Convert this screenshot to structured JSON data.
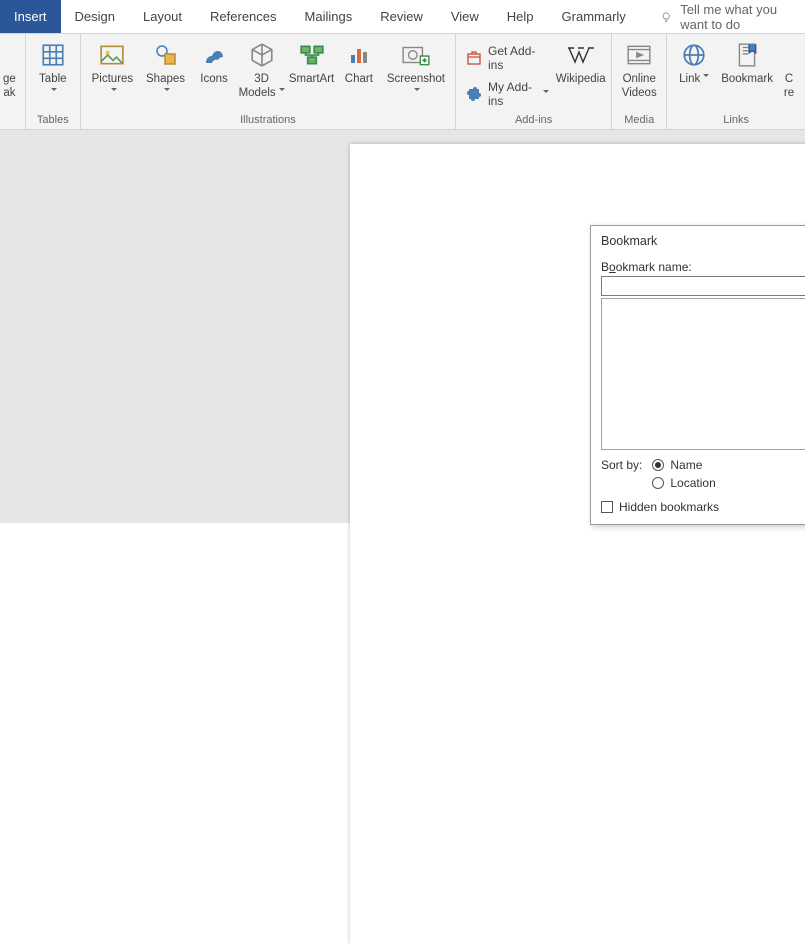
{
  "tabs": {
    "items": [
      "Insert",
      "Design",
      "Layout",
      "References",
      "Mailings",
      "Review",
      "View",
      "Help",
      "Grammarly"
    ],
    "active_index": 0,
    "tell_me": "Tell me what you want to do"
  },
  "ribbon": {
    "tables": {
      "label": "Tables",
      "page_break": "ge\nak",
      "table": "Table"
    },
    "illustrations": {
      "label": "Illustrations",
      "pictures": "Pictures",
      "shapes": "Shapes",
      "icons": "Icons",
      "models": "3D\nModels",
      "smartart": "SmartArt",
      "chart": "Chart",
      "screenshot": "Screenshot"
    },
    "addins": {
      "label": "Add-ins",
      "get": "Get Add-ins",
      "my": "My Add-ins",
      "wikipedia": "Wikipedia"
    },
    "media": {
      "label": "Media",
      "online_videos": "Online\nVideos"
    },
    "links": {
      "label": "Links",
      "link": "Link",
      "bookmark": "Bookmark",
      "cross_ref": "C\nre"
    }
  },
  "dialog": {
    "title": "Bookmark",
    "name_label_pre": "B",
    "name_label_u": "o",
    "name_label_post": "okmark name:",
    "name_value": "",
    "sort_label": "Sort by:",
    "sort_name_u": "N",
    "sort_name_post": "ame",
    "sort_loc_u": "L",
    "sort_loc_post": "ocation",
    "sort_selected": "name",
    "hidden_u": "H",
    "hidden_post": "idden bookmarks",
    "hidden_checked": false
  }
}
